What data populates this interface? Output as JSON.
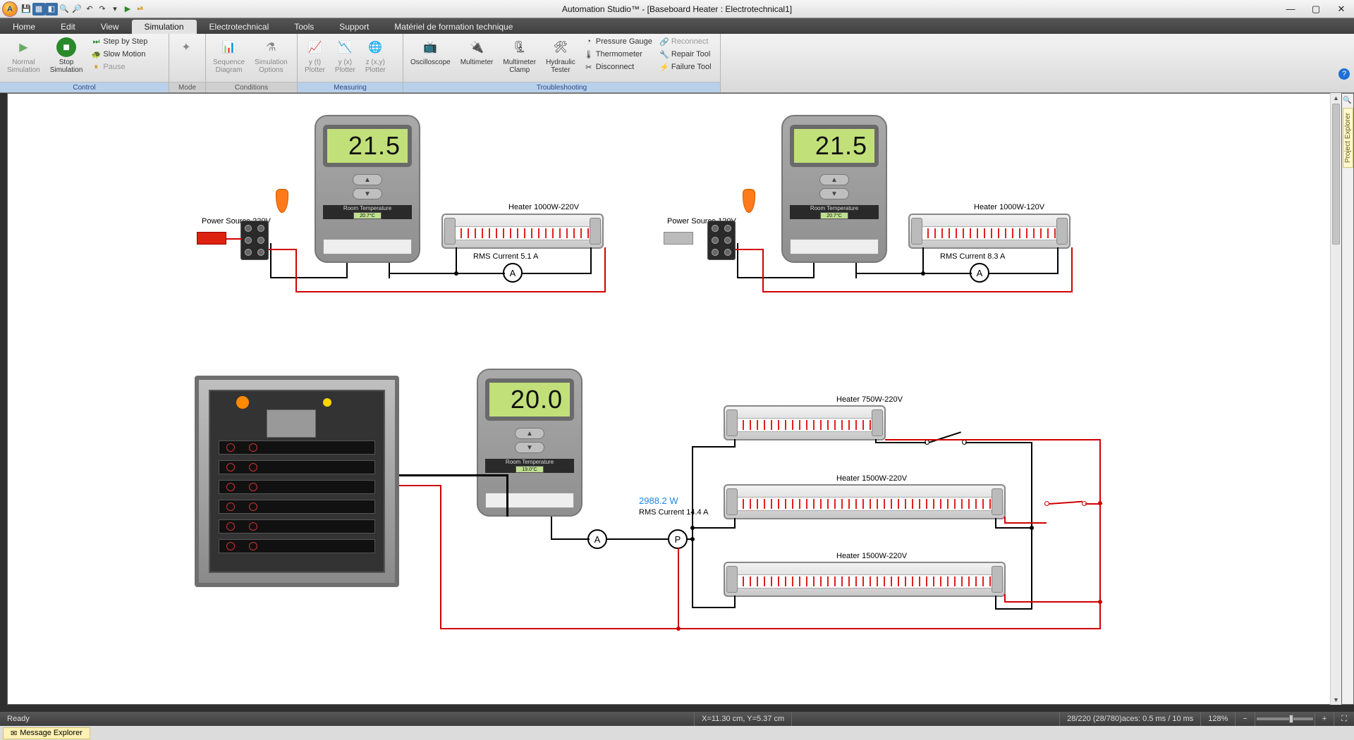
{
  "title": "Automation Studio™ - [Baseboard Heater : Electrotechnical1]",
  "tabs": [
    "Home",
    "Edit",
    "View",
    "Simulation",
    "Electrotechnical",
    "Tools",
    "Support",
    "Matériel de formation technique"
  ],
  "active_tab": 3,
  "ribbon": {
    "control": {
      "label": "Control",
      "normal_sim": "Normal\nSimulation",
      "stop_sim": "Stop\nSimulation",
      "step": "Step by Step",
      "slow": "Slow Motion",
      "pause": "Pause"
    },
    "mode": {
      "label": "Mode"
    },
    "conditions": {
      "label": "Conditions",
      "seq": "Sequence\nDiagram",
      "opts": "Simulation\nOptions"
    },
    "measuring": {
      "label": "Measuring",
      "yt": "y (t)\nPlotter",
      "yx": "y (x)\nPlotter",
      "zxy": "z (x,y)\nPlotter"
    },
    "trouble": {
      "label": "Troubleshooting",
      "osc": "Oscilloscope",
      "mm": "Multimeter",
      "clamp": "Multimeter\nClamp",
      "ht": "Hydraulic\nTester",
      "pg": "Pressure Gauge",
      "th": "Thermometer",
      "dc": "Disconnect",
      "rc": "Reconnect",
      "rt": "Repair Tool",
      "ft": "Failure Tool"
    }
  },
  "circuit": {
    "c1": {
      "power_label": "Power Source 220V",
      "heater_label": "Heater 1000W-220V",
      "rms": "RMS Current 5.1 A",
      "thermo_reading": "21.5",
      "room_temp_label": "Room Temperature",
      "room_temp": "20.7°C"
    },
    "c2": {
      "power_label": "Power Source 120V",
      "heater_label": "Heater 1000W-120V",
      "rms": "RMS Current 8.3 A",
      "thermo_reading": "21.5",
      "room_temp_label": "Room Temperature",
      "room_temp": "20.7°C"
    },
    "c3": {
      "thermo_reading": "20.0",
      "room_temp_label": "Room Temperature",
      "room_temp": "19.0°C",
      "rms": "RMS Current 14.4 A",
      "power_reading": "2988.2 W",
      "heater_a": "Heater 750W-220V",
      "heater_b": "Heater 1500W-220V",
      "heater_c": "Heater 1500W-220V"
    }
  },
  "status": {
    "ready": "Ready",
    "coords": "X=11.30 cm, Y=5.37 cm",
    "perf": "28/220 (28/780)aces: 0.5 ms / 10 ms",
    "zoom": "128%"
  },
  "task": {
    "msg": "Message Explorer"
  },
  "right_rail": "Project Explorer"
}
